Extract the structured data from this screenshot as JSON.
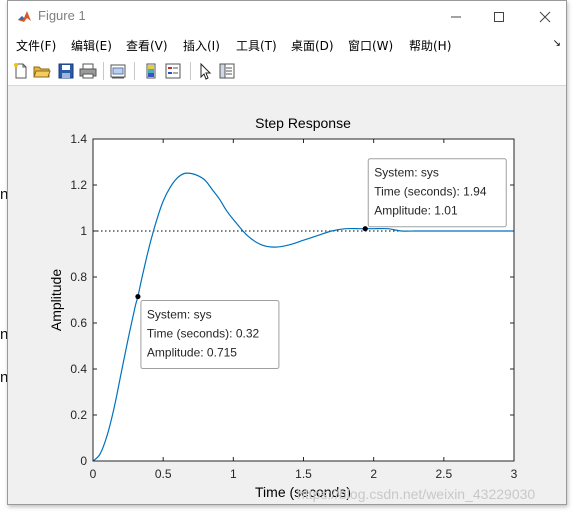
{
  "background_fragments": [
    "n",
    "n",
    "n"
  ],
  "window": {
    "title": "Figure 1",
    "minimize_glyph": "─",
    "maximize_glyph": "☐",
    "close_glyph": "✕"
  },
  "menu": {
    "items": [
      "文件(F)",
      "编辑(E)",
      "查看(V)",
      "插入(I)",
      "工具(T)",
      "桌面(D)",
      "窗口(W)",
      "帮助(H)"
    ],
    "overflow_glyph": "↘"
  },
  "toolbar": {
    "icons": [
      "new-figure-icon",
      "open-file-icon",
      "save-icon",
      "print-icon",
      "link-plot-icon",
      "insert-colorbar-icon",
      "insert-legend-icon",
      "edit-plot-icon",
      "property-inspector-icon"
    ]
  },
  "colors": {
    "line": "#0072bd",
    "axes": "#262626",
    "grid_line": "#000000",
    "datatip_bg": "#ffffff",
    "datatip_border": "#a0a0a0"
  },
  "chart_data": {
    "type": "line",
    "title": "Step Response",
    "xlabel": "Time (seconds)",
    "ylabel": "Amplitude",
    "xlim": [
      0,
      3
    ],
    "ylim": [
      0,
      1.4
    ],
    "xticks": [
      "0",
      "0.5",
      "1",
      "1.5",
      "2",
      "2.5",
      "3"
    ],
    "yticks": [
      "0",
      "0.2",
      "0.4",
      "0.6",
      "0.8",
      "1",
      "1.2",
      "1.4"
    ],
    "steady_state_reference": 1,
    "series": [
      {
        "name": "sys",
        "x": [
          0,
          0.05,
          0.1,
          0.15,
          0.2,
          0.25,
          0.3,
          0.32,
          0.35,
          0.4,
          0.45,
          0.5,
          0.55,
          0.6,
          0.65,
          0.7,
          0.75,
          0.8,
          0.85,
          0.9,
          0.95,
          1.0,
          1.1,
          1.2,
          1.3,
          1.4,
          1.5,
          1.6,
          1.7,
          1.8,
          1.9,
          1.94,
          2.0,
          2.1,
          2.2,
          2.3,
          2.4,
          2.5,
          2.6,
          2.7,
          2.8,
          2.9,
          3.0
        ],
        "y": [
          0,
          0.03,
          0.11,
          0.23,
          0.38,
          0.53,
          0.67,
          0.715,
          0.8,
          0.93,
          1.04,
          1.13,
          1.19,
          1.23,
          1.25,
          1.25,
          1.24,
          1.22,
          1.18,
          1.14,
          1.09,
          1.05,
          0.98,
          0.94,
          0.93,
          0.94,
          0.96,
          0.98,
          1.0,
          1.01,
          1.01,
          1.01,
          1.01,
          1.01,
          1.0,
          1.0,
          1.0,
          1.0,
          1.0,
          1.0,
          1.0,
          1.0,
          1.0
        ]
      }
    ],
    "datatips": [
      {
        "x": 0.32,
        "y": 0.715,
        "lines": [
          "System: sys",
          "Time (seconds): 0.32",
          "Amplitude: 0.715"
        ]
      },
      {
        "x": 1.94,
        "y": 1.01,
        "lines": [
          "System: sys",
          "Time (seconds): 1.94",
          "Amplitude: 1.01"
        ]
      }
    ],
    "grid": false,
    "legend": "none"
  },
  "watermark": "https://blog.csdn.net/weixin_43229030"
}
